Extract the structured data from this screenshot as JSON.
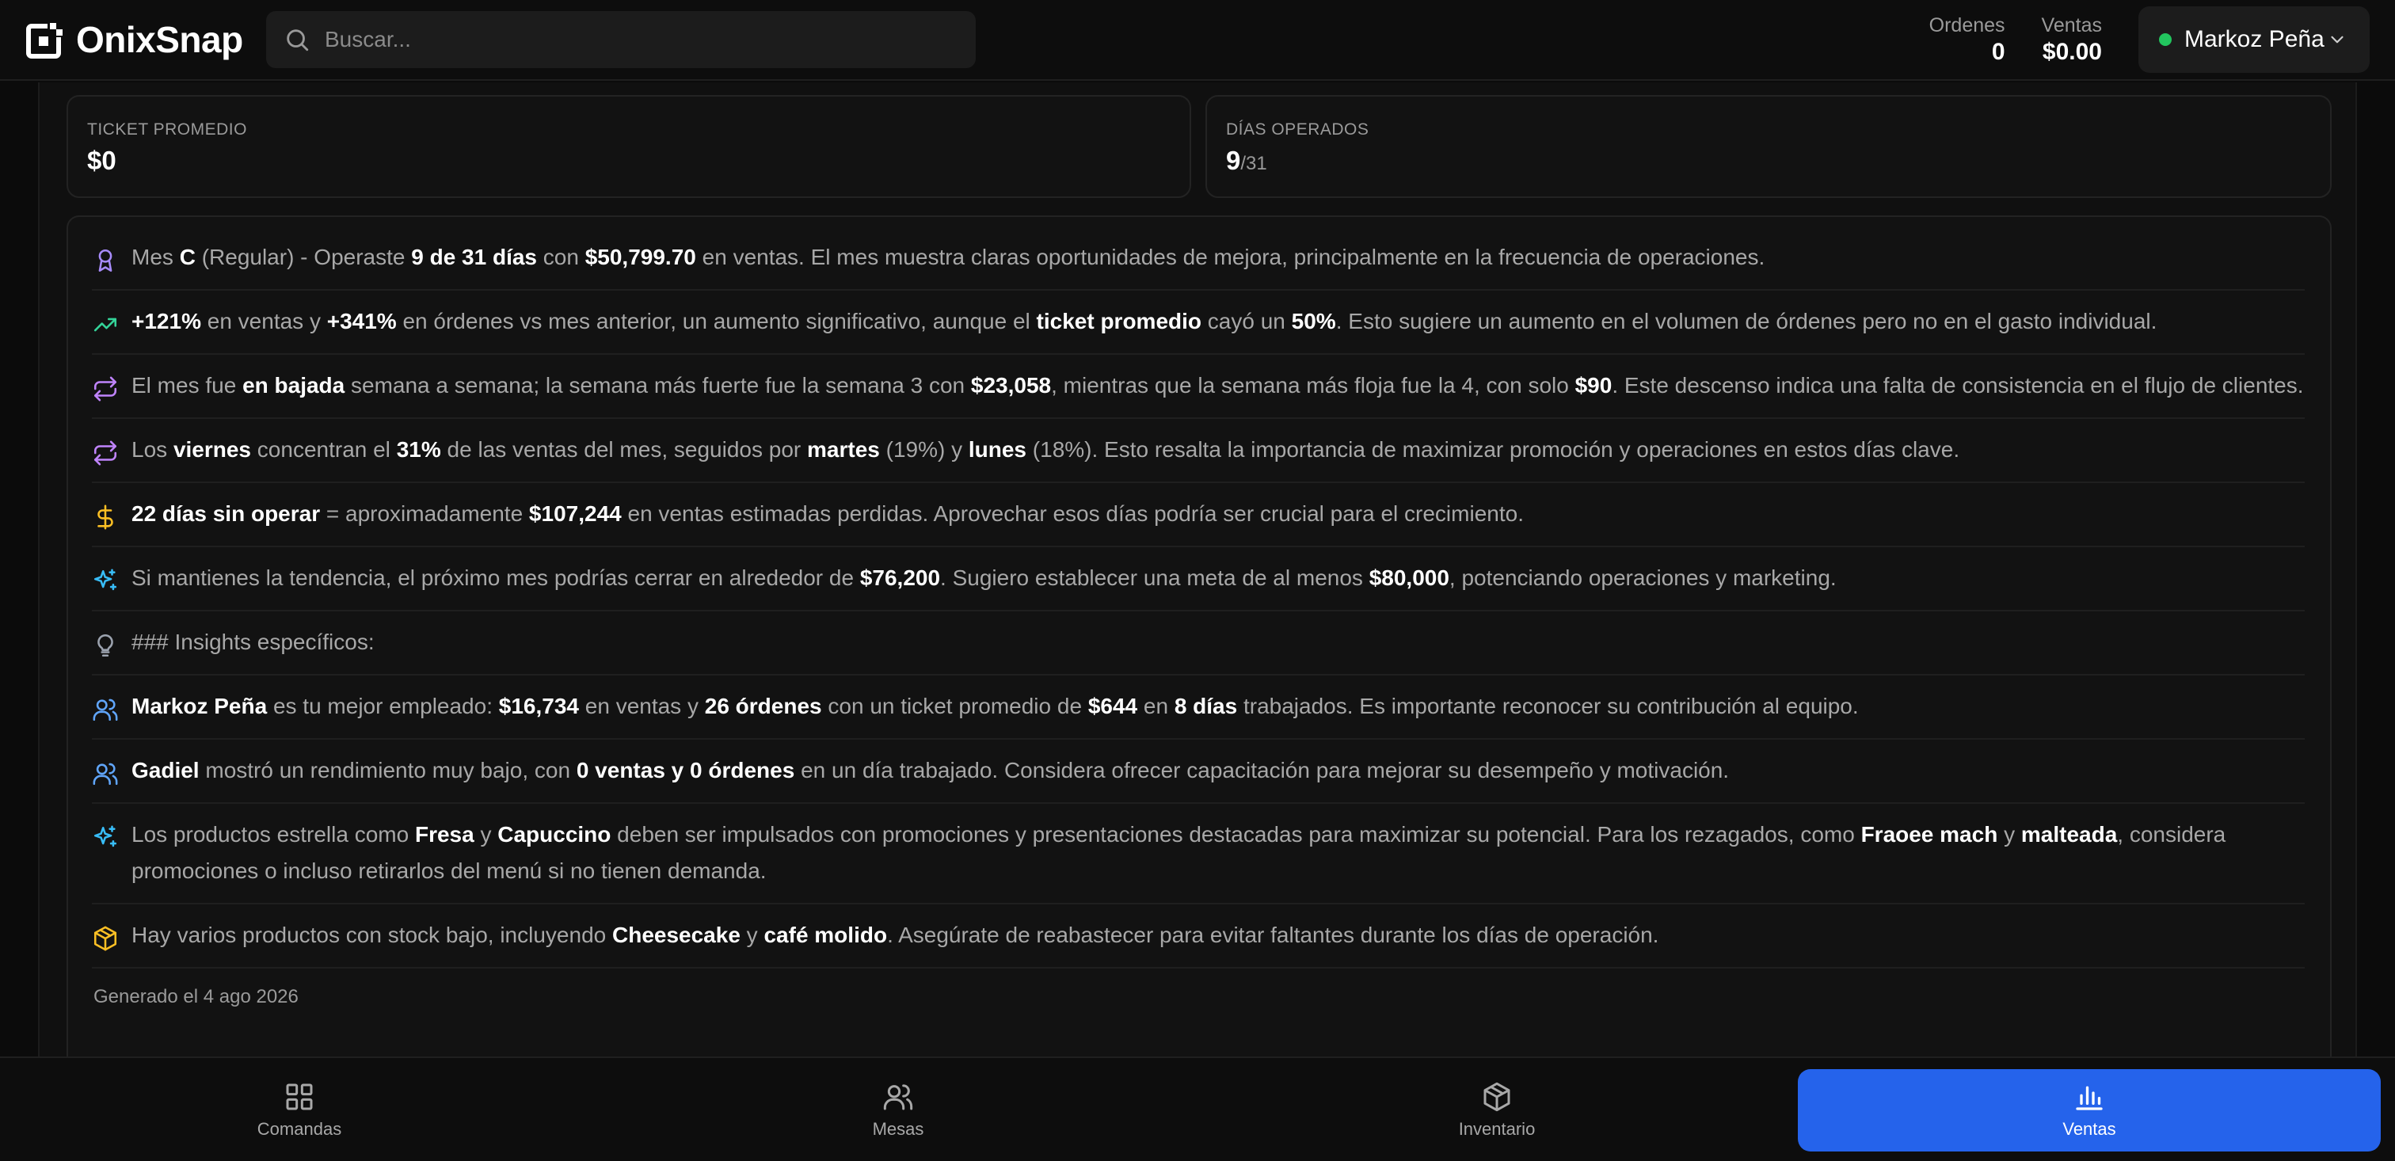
{
  "brand": {
    "name": "OnixSnap"
  },
  "search": {
    "placeholder": "Buscar..."
  },
  "header_stats": [
    {
      "label": "Ordenes",
      "value": "0"
    },
    {
      "label": "Ventas",
      "value": "$0.00"
    }
  ],
  "user": {
    "name": "Markoz Peña",
    "status_color": "#22c55e"
  },
  "metrics": [
    {
      "label": "TICKET PROMEDIO",
      "value": "$0",
      "suffix": ""
    },
    {
      "label": "DÍAS OPERADOS",
      "value": "9",
      "suffix": "/31"
    }
  ],
  "insights": [
    {
      "icon": "award-icon",
      "color": "#a78bfa",
      "segments": [
        {
          "t": "Mes "
        },
        {
          "t": "C",
          "b": true
        },
        {
          "t": " (Regular) - Operaste "
        },
        {
          "t": "9 de 31 días",
          "b": true
        },
        {
          "t": " con "
        },
        {
          "t": "$50,799.70",
          "b": true
        },
        {
          "t": " en ventas. El mes muestra claras oportunidades de mejora, principalmente en la frecuencia de operaciones."
        }
      ]
    },
    {
      "icon": "trending-up-icon",
      "color": "#34d399",
      "segments": [
        {
          "t": "+121%",
          "b": true
        },
        {
          "t": " en ventas y "
        },
        {
          "t": "+341%",
          "b": true
        },
        {
          "t": " en órdenes vs mes anterior, un aumento significativo, aunque el "
        },
        {
          "t": "ticket promedio",
          "b": true
        },
        {
          "t": " cayó un "
        },
        {
          "t": "50%",
          "b": true
        },
        {
          "t": ". Esto sugiere un aumento en el volumen de órdenes pero no en el gasto individual."
        }
      ]
    },
    {
      "icon": "repeat-icon",
      "color": "#c084fc",
      "segments": [
        {
          "t": "El mes fue "
        },
        {
          "t": "en bajada",
          "b": true
        },
        {
          "t": " semana a semana; la semana más fuerte fue la semana 3 con "
        },
        {
          "t": "$23,058",
          "b": true
        },
        {
          "t": ", mientras que la semana más floja fue la 4, con solo "
        },
        {
          "t": "$90",
          "b": true
        },
        {
          "t": ". Este descenso indica una falta de consistencia en el flujo de clientes."
        }
      ]
    },
    {
      "icon": "repeat-icon",
      "color": "#c084fc",
      "segments": [
        {
          "t": "Los "
        },
        {
          "t": "viernes",
          "b": true
        },
        {
          "t": " concentran el "
        },
        {
          "t": "31%",
          "b": true
        },
        {
          "t": " de las ventas del mes, seguidos por "
        },
        {
          "t": "martes",
          "b": true
        },
        {
          "t": " (19%) y "
        },
        {
          "t": "lunes",
          "b": true
        },
        {
          "t": " (18%). Esto resalta la importancia de maximizar promoción y operaciones en estos días clave."
        }
      ]
    },
    {
      "icon": "dollar-icon",
      "color": "#fbbf24",
      "segments": [
        {
          "t": "22 días sin operar",
          "b": true
        },
        {
          "t": " = aproximadamente "
        },
        {
          "t": "$107,244",
          "b": true
        },
        {
          "t": " en ventas estimadas perdidas. Aprovechar esos días podría ser crucial para el crecimiento."
        }
      ]
    },
    {
      "icon": "sparkles-icon",
      "color": "#38bdf8",
      "segments": [
        {
          "t": "Si mantienes la tendencia, el próximo mes podrías cerrar en alrededor de "
        },
        {
          "t": "$76,200",
          "b": true
        },
        {
          "t": ". Sugiero establecer una meta de al menos "
        },
        {
          "t": "$80,000",
          "b": true
        },
        {
          "t": ", potenciando operaciones y marketing."
        }
      ]
    },
    {
      "icon": "lightbulb-icon",
      "color": "#9ca3af",
      "segments": [
        {
          "t": "### Insights específicos:"
        }
      ]
    },
    {
      "icon": "users-icon",
      "color": "#60a5fa",
      "segments": [
        {
          "t": "Markoz Peña",
          "b": true
        },
        {
          "t": " es tu mejor empleado: "
        },
        {
          "t": "$16,734",
          "b": true
        },
        {
          "t": " en ventas y "
        },
        {
          "t": "26 órdenes",
          "b": true
        },
        {
          "t": " con un ticket promedio de "
        },
        {
          "t": "$644",
          "b": true
        },
        {
          "t": " en "
        },
        {
          "t": "8 días",
          "b": true
        },
        {
          "t": " trabajados. Es importante reconocer su contribución al equipo."
        }
      ]
    },
    {
      "icon": "users-icon",
      "color": "#60a5fa",
      "segments": [
        {
          "t": "Gadiel",
          "b": true
        },
        {
          "t": " mostró un rendimiento muy bajo, con "
        },
        {
          "t": "0 ventas y 0 órdenes",
          "b": true
        },
        {
          "t": " en un día trabajado. Considera ofrecer capacitación para mejorar su desempeño y motivación."
        }
      ]
    },
    {
      "icon": "sparkles-icon",
      "color": "#38bdf8",
      "segments": [
        {
          "t": "Los productos estrella como "
        },
        {
          "t": "Fresa",
          "b": true
        },
        {
          "t": " y "
        },
        {
          "t": "Capuccino",
          "b": true
        },
        {
          "t": " deben ser impulsados con promociones y presentaciones destacadas para maximizar su potencial. Para los rezagados, como "
        },
        {
          "t": "Fraoee mach",
          "b": true
        },
        {
          "t": " y "
        },
        {
          "t": "malteada",
          "b": true
        },
        {
          "t": ", considera promociones o incluso retirarlos del menú si no tienen demanda."
        }
      ]
    },
    {
      "icon": "package-icon",
      "color": "#fbbf24",
      "segments": [
        {
          "t": "Hay varios productos con stock bajo, incluyendo "
        },
        {
          "t": "Cheesecake",
          "b": true
        },
        {
          "t": " y "
        },
        {
          "t": "café molido",
          "b": true
        },
        {
          "t": ". Asegúrate de reabastecer para evitar faltantes durante los días de operación."
        }
      ]
    }
  ],
  "generated": "Generado el 4 ago 2026",
  "nav": [
    {
      "label": "Comandas",
      "icon": "grid-icon",
      "active": false
    },
    {
      "label": "Mesas",
      "icon": "users-icon",
      "active": false
    },
    {
      "label": "Inventario",
      "icon": "package-icon",
      "active": false
    },
    {
      "label": "Ventas",
      "icon": "bar-chart-icon",
      "active": true
    }
  ],
  "colors": {
    "accent": "#2563eb",
    "online": "#22c55e"
  }
}
